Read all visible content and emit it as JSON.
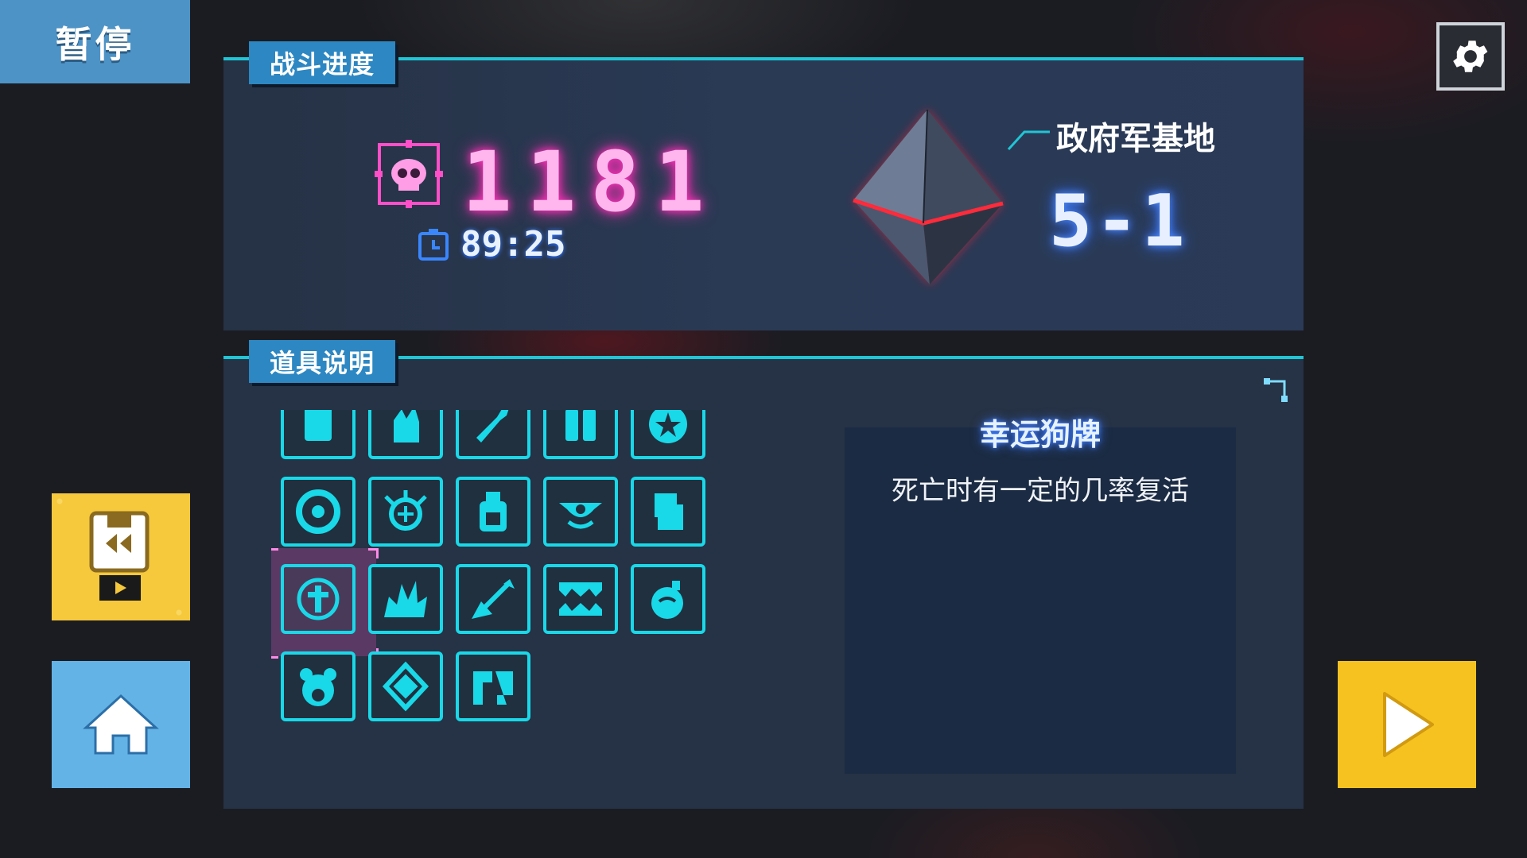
{
  "pause": {
    "label": "暂停"
  },
  "settings": {
    "icon": "gear-icon"
  },
  "battle": {
    "header": "战斗进度",
    "kills": "1181",
    "time": "89:25",
    "location": "政府军基地",
    "stage": "5-1"
  },
  "items": {
    "header": "道具说明",
    "selected_title": "幸运狗牌",
    "selected_desc": "死亡时有一定的几率复活",
    "icons": [
      "armor-icon",
      "fire-hand-icon",
      "wrench-icon",
      "boots-icon",
      "star-badge-icon",
      "target-ring-icon",
      "spiked-orb-icon",
      "potion-jar-icon",
      "eye-icon",
      "fist-icon",
      "cross-badge-icon",
      "explosion-icon",
      "arrow-burst-icon",
      "fangs-icon",
      "bomb-icon",
      "skull-bear-icon",
      "crystal-burst-icon",
      "broken-shield-icon"
    ]
  },
  "colors": {
    "accent": "#1fc6d6",
    "kill_glow": "#ff2fb8",
    "stage_glow": "#4f8cff"
  }
}
